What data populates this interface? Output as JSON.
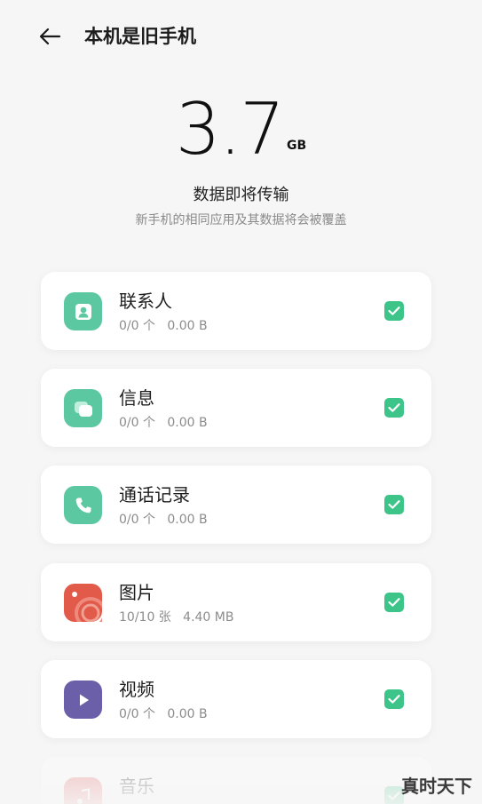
{
  "header": {
    "title": "本机是旧手机"
  },
  "summary": {
    "size_value": "3.7",
    "size_unit": "GB",
    "status": "数据即将传输",
    "note": "新手机的相同应用及其数据将会被覆盖"
  },
  "colors": {
    "accent_green": "#3cc489",
    "contacts_icon": "#5cc8a2",
    "messages_icon": "#5cc8a2",
    "calls_icon": "#5cc8a2",
    "photos_icon": "#e15a4a",
    "videos_icon": "#6a5fa8",
    "music_icon": "#e86a6a"
  },
  "items": [
    {
      "name": "联系人",
      "count": "0/0 个",
      "size": "0.00 B",
      "icon": "contacts-icon",
      "checked": true
    },
    {
      "name": "信息",
      "count": "0/0 个",
      "size": "0.00 B",
      "icon": "messages-icon",
      "checked": true
    },
    {
      "name": "通话记录",
      "count": "0/0 个",
      "size": "0.00 B",
      "icon": "phone-icon",
      "checked": true
    },
    {
      "name": "图片",
      "count": "10/10 张",
      "size": "4.40 MB",
      "icon": "photos-icon",
      "checked": true
    },
    {
      "name": "视频",
      "count": "0/0 个",
      "size": "0.00 B",
      "icon": "play-icon",
      "checked": true
    },
    {
      "name": "音乐",
      "count": "",
      "size": "",
      "icon": "music-icon",
      "checked": true
    }
  ],
  "watermark": "真时天下"
}
